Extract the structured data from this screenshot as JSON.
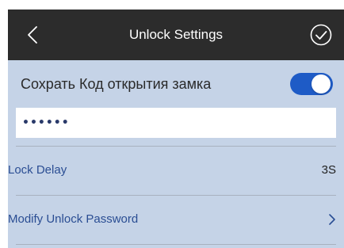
{
  "navbar": {
    "back_icon": "chevron-left-icon",
    "title": "Unlock Settings",
    "confirm_icon": "check-circle-icon"
  },
  "save_code": {
    "label": "Сохрать Код открытия замка",
    "toggle_on": true,
    "accent_color": "#1e5bc6"
  },
  "password_field": {
    "value": "••••••"
  },
  "settings": {
    "lock_delay": {
      "label": "Lock Delay",
      "value": "3S"
    },
    "modify_password": {
      "label": "Modify Unlock Password",
      "icon": "chevron-right-icon"
    }
  },
  "colors": {
    "navbar_bg": "#2c2c2c",
    "content_bg": "#c5d3e7",
    "link_text": "#2a4d93"
  }
}
